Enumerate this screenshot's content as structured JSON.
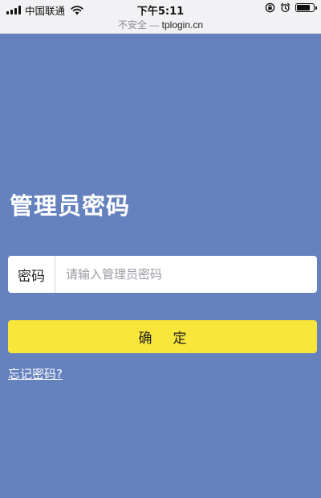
{
  "status_bar": {
    "carrier": "中国联通",
    "time": "下午5:11",
    "battery_level": 0.85,
    "icons": [
      "signal-icon",
      "wifi-icon",
      "rotation-lock-icon",
      "alarm-icon",
      "battery-icon"
    ]
  },
  "browser": {
    "security_label": "不安全 —",
    "url": "tplogin.cn"
  },
  "login": {
    "title": "管理员密码",
    "password_label": "密码",
    "password_placeholder": "请输入管理员密码",
    "password_value": "",
    "confirm_label": "确定",
    "forgot_label": "忘记密码?"
  },
  "colors": {
    "background": "#6582bf",
    "button": "#f8e63a",
    "input_bg": "#ffffff",
    "text_light": "#ffffff"
  }
}
